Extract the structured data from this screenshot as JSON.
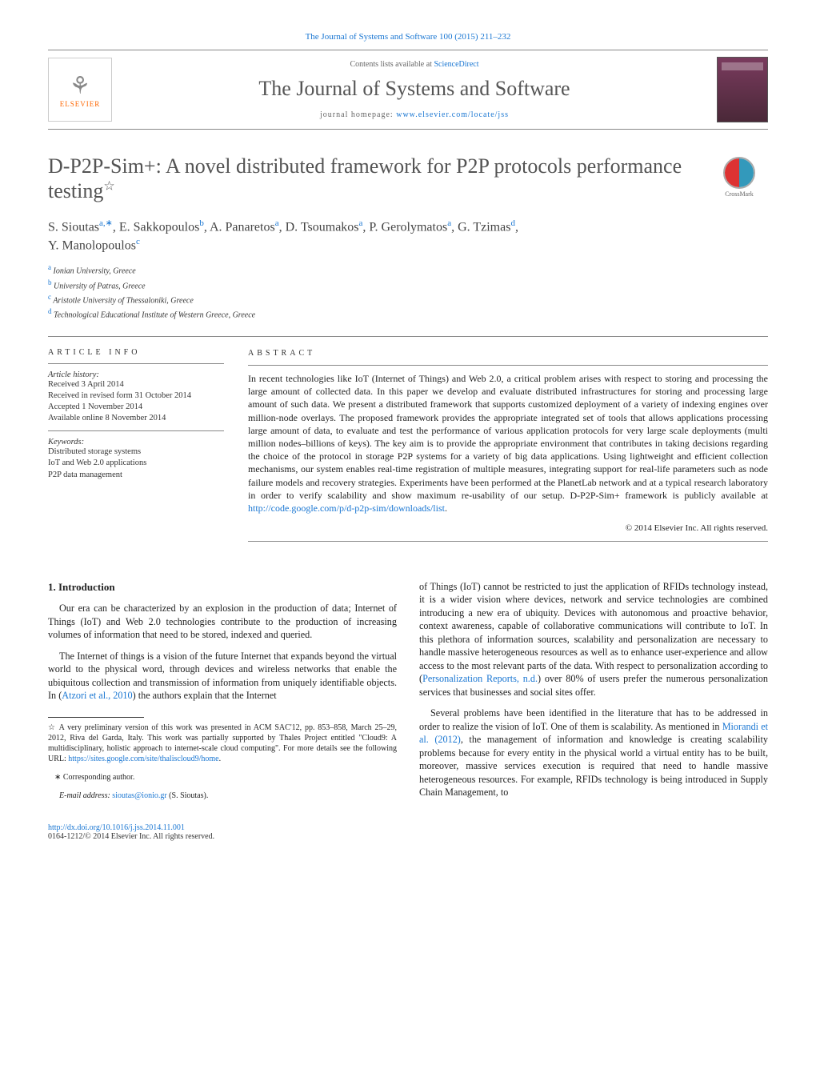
{
  "header": {
    "citation": "The Journal of Systems and Software 100 (2015) 211–232",
    "contents_prefix": "Contents lists available at ",
    "contents_link": "ScienceDirect",
    "journal_title": "The Journal of Systems and Software",
    "homepage_prefix": "journal homepage: ",
    "homepage_url": "www.elsevier.com/locate/jss",
    "publisher_name": "ELSEVIER"
  },
  "crossmark_label": "CrossMark",
  "article": {
    "title": "D-P2P-Sim+: A novel distributed framework for P2P protocols performance testing",
    "title_footnote_marker": "☆",
    "authors_line_1": "S. Sioutas",
    "authors_1_sup": "a,∗",
    "authors_2": ", E. Sakkopoulos",
    "authors_2_sup": "b",
    "authors_3": ", A. Panaretos",
    "authors_3_sup": "a",
    "authors_4": ", D. Tsoumakos",
    "authors_4_sup": "a",
    "authors_5": ", P. Gerolymatos",
    "authors_5_sup": "a",
    "authors_6": ", G. Tzimas",
    "authors_6_sup": "d",
    "authors_7": "Y. Manolopoulos",
    "authors_7_sup": "c",
    "affiliations": {
      "a": "Ionian University, Greece",
      "b": "University of Patras, Greece",
      "c": "Aristotle University of Thessaloniki, Greece",
      "d": "Technological Educational Institute of Western Greece, Greece"
    }
  },
  "info": {
    "head": "ARTICLE INFO",
    "history_label": "Article history:",
    "history": [
      "Received 3 April 2014",
      "Received in revised form 31 October 2014",
      "Accepted 1 November 2014",
      "Available online 8 November 2014"
    ],
    "keywords_label": "Keywords:",
    "keywords": [
      "Distributed storage systems",
      "IoT and Web 2.0 applications",
      "P2P data management"
    ]
  },
  "abstract": {
    "head": "ABSTRACT",
    "text": "In recent technologies like IoT (Internet of Things) and Web 2.0, a critical problem arises with respect to storing and processing the large amount of collected data. In this paper we develop and evaluate distributed infrastructures for storing and processing large amount of such data. We present a distributed framework that supports customized deployment of a variety of indexing engines over million-node overlays. The proposed framework provides the appropriate integrated set of tools that allows applications processing large amount of data, to evaluate and test the performance of various application protocols for very large scale deployments (multi million nodes–billions of keys). The key aim is to provide the appropriate environment that contributes in taking decisions regarding the choice of the protocol in storage P2P systems for a variety of big data applications. Using lightweight and efficient collection mechanisms, our system enables real-time registration of multiple measures, integrating support for real-life parameters such as node failure models and recovery strategies. Experiments have been performed at the PlanetLab network and at a typical research laboratory in order to verify scalability and show maximum re-usability of our setup. D-P2P-Sim+ framework is publicly available at ",
    "link": "http://code.google.com/p/d-p2p-sim/downloads/list",
    "tail": ".",
    "copyright": "© 2014 Elsevier Inc. All rights reserved."
  },
  "body": {
    "section_heading": "1.  Introduction",
    "col1_p1": "Our era can be characterized by an explosion in the production of data; Internet of Things (IoT) and Web 2.0 technologies contribute to the production of increasing volumes of information that need to be stored, indexed and queried.",
    "col1_p2_a": "The Internet of things is a vision of the future Internet that expands beyond the virtual world to the physical word, through devices and wireless networks that enable the ubiquitous collection and transmission of information from uniquely identifiable objects. In (",
    "col1_p2_link": "Atzori et al., 2010",
    "col1_p2_b": ") the authors explain that the Internet",
    "col2_p1_a": "of Things (IoT) cannot be restricted to just the application of RFIDs technology instead, it is a wider vision where devices, network and service technologies are combined introducing a new era of ubiquity. Devices with autonomous and proactive behavior, context awareness, capable of collaborative communications will contribute to IoT. In this plethora of information sources, scalability and personalization are necessary to handle massive heterogeneous resources as well as to enhance user-experience and allow access to the most relevant parts of the data. With respect to personalization according to (",
    "col2_p1_link": "Personalization Reports, n.d.",
    "col2_p1_b": ") over 80% of users prefer the numerous personalization services that businesses and social sites offer.",
    "col2_p2_a": "Several problems have been identified in the literature that has to be addressed in order to realize the vision of IoT. One of them is scalability. As mentioned in ",
    "col2_p2_link": "Miorandi et al. (2012)",
    "col2_p2_b": ", the management of information and knowledge is creating scalability problems because for every entity in the physical world a virtual entity has to be built, moreover, massive services execution is required that need to handle massive heterogeneous resources. For example, RFIDs technology is being introduced in Supply Chain Management, to"
  },
  "footnotes": {
    "star_note_a": "A very preliminary version of this work was presented in ACM SAC'12, pp. 853–858, March 25–29, 2012, Riva del Garda, Italy. This work was partially supported by Thales Project entitled \"Cloud9: A multidisciplinary, holistic approach to internet-scale cloud computing\". For more details see the following URL: ",
    "star_note_link": "https://sites.google.com/site/thaliscloud9/home",
    "star_note_b": ".",
    "corr_label": "Corresponding author.",
    "email_label": "E-mail address:",
    "email": "sioutas@ionio.gr",
    "email_tail": " (S. Sioutas)."
  },
  "bottom": {
    "doi": "http://dx.doi.org/10.1016/j.jss.2014.11.001",
    "issn_line": "0164-1212/© 2014 Elsevier Inc. All rights reserved."
  }
}
